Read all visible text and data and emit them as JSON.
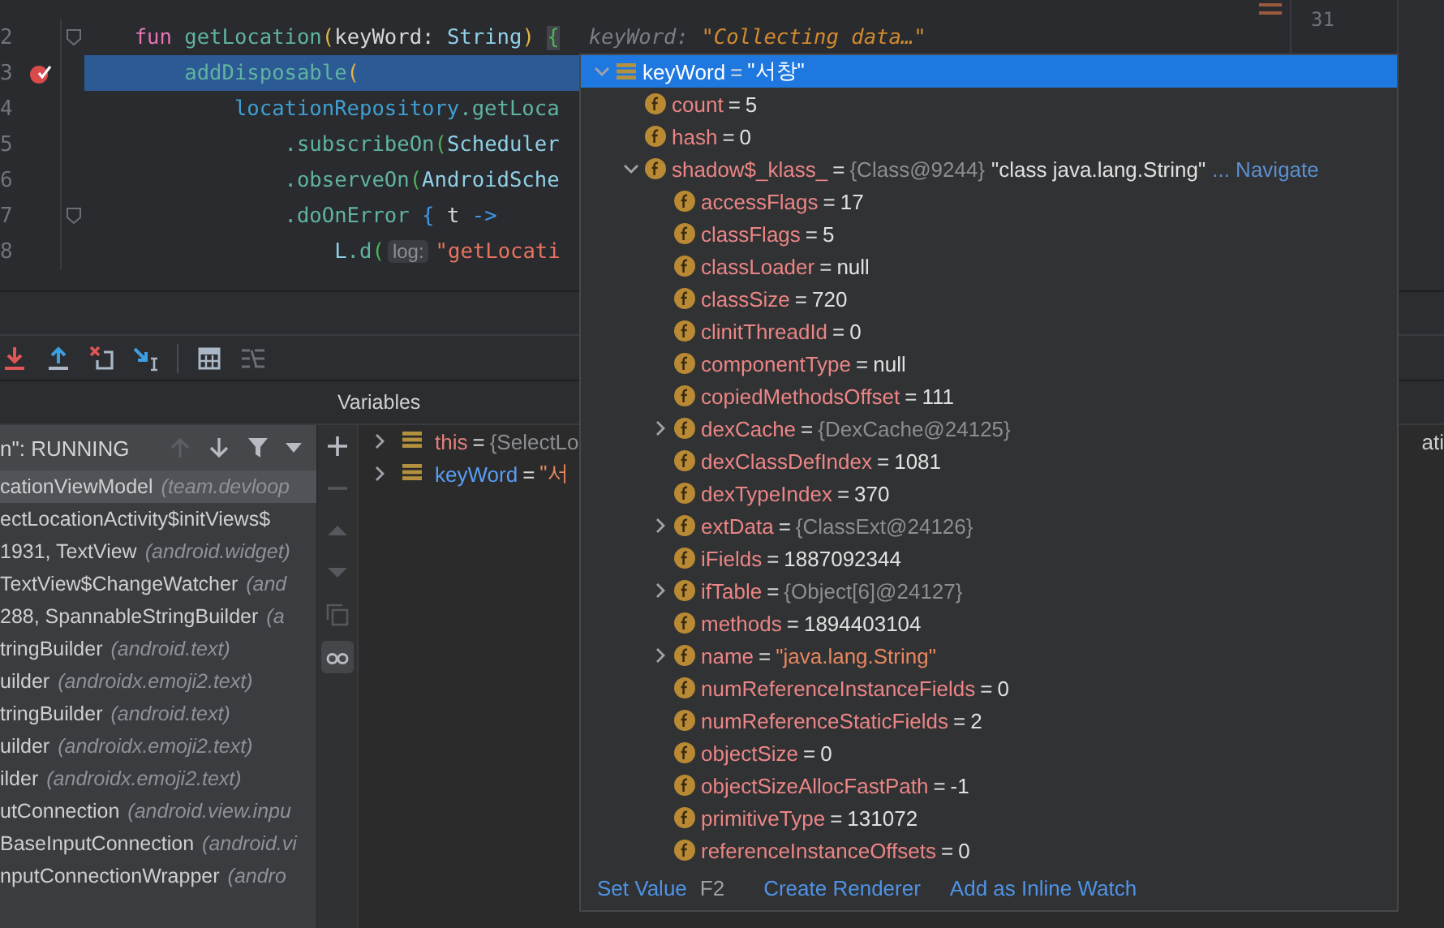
{
  "editor": {
    "lines": [
      {
        "number": "2",
        "fold": true,
        "breakpoint": false,
        "highlighted": false,
        "tokens": [
          {
            "kind": "keyword",
            "text": "    fun "
          },
          {
            "kind": "function",
            "text": "getLocation"
          },
          {
            "kind": "paren",
            "text": "("
          },
          {
            "kind": "plain",
            "text": "keyWord: "
          },
          {
            "kind": "type",
            "text": "String"
          },
          {
            "kind": "paren",
            "text": ") "
          },
          {
            "kind": "brace_match",
            "text": "{"
          }
        ],
        "inline_value": {
          "name": "keyWord:",
          "value": "\"Collecting data…\""
        }
      },
      {
        "number": "3",
        "fold": false,
        "breakpoint": true,
        "highlighted": true,
        "tokens": [
          {
            "kind": "function",
            "text": "        addDisposable"
          },
          {
            "kind": "paren",
            "text": "("
          }
        ]
      },
      {
        "number": "4",
        "fold": false,
        "breakpoint": false,
        "highlighted": false,
        "tokens": [
          {
            "kind": "property",
            "text": "            locationRepository"
          },
          {
            "kind": "function",
            "text": ".getLoca"
          }
        ]
      },
      {
        "number": "5",
        "fold": false,
        "breakpoint": false,
        "highlighted": false,
        "tokens": [
          {
            "kind": "function",
            "text": "                .subscribeOn"
          },
          {
            "kind": "paren2",
            "text": "("
          },
          {
            "kind": "type",
            "text": "Scheduler"
          }
        ]
      },
      {
        "number": "6",
        "fold": false,
        "breakpoint": false,
        "highlighted": false,
        "tokens": [
          {
            "kind": "function",
            "text": "                .observeOn"
          },
          {
            "kind": "paren2",
            "text": "("
          },
          {
            "kind": "type",
            "text": "AndroidSche"
          }
        ]
      },
      {
        "number": "7",
        "fold": true,
        "breakpoint": false,
        "highlighted": false,
        "tokens": [
          {
            "kind": "function",
            "text": "                .doOnError "
          },
          {
            "kind": "brace",
            "text": "{"
          },
          {
            "kind": "plain",
            "text": " t "
          },
          {
            "kind": "brace",
            "text": "->"
          }
        ]
      },
      {
        "number": "8",
        "fold": false,
        "breakpoint": false,
        "highlighted": false,
        "tokens": [
          {
            "kind": "type",
            "text": "                    L"
          },
          {
            "kind": "function",
            "text": ".d"
          },
          {
            "kind": "paren2",
            "text": "("
          },
          {
            "kind": "hint",
            "text": "log:"
          },
          {
            "kind": "string",
            "text": "\"getLocati"
          }
        ]
      }
    ],
    "split_line_numbers": [
      "31"
    ]
  },
  "debugger": {
    "toolbar": [
      {
        "kind": "step_into",
        "disabled": false
      },
      {
        "kind": "step_out",
        "disabled": false
      },
      {
        "kind": "drop_frame",
        "disabled": false
      },
      {
        "kind": "run_to_cursor",
        "disabled": false
      },
      {
        "kind": "separator"
      },
      {
        "kind": "evaluate",
        "disabled": false
      },
      {
        "kind": "trace",
        "disabled": true
      }
    ],
    "thread": {
      "label": "n\": RUNNING",
      "tools": [
        {
          "kind": "up",
          "disabled": true
        },
        {
          "kind": "down",
          "disabled": false
        },
        {
          "kind": "filter",
          "disabled": false
        },
        {
          "kind": "caret",
          "disabled": false
        }
      ]
    },
    "frames": [
      {
        "method": "cationViewModel",
        "package": "(team.devloop",
        "selected": true
      },
      {
        "method": "ectLocationActivity$initViews$",
        "selected": false
      },
      {
        "method": "1931, TextView",
        "package": "(android.widget)",
        "selected": false
      },
      {
        "method": "TextView$ChangeWatcher",
        "package": "(and",
        "selected": false
      },
      {
        "method": "288, SpannableStringBuilder",
        "package": "(a",
        "selected": false
      },
      {
        "method": "tringBuilder",
        "package": "(android.text)",
        "selected": false
      },
      {
        "method": "uilder",
        "package": "(androidx.emoji2.text)",
        "selected": false
      },
      {
        "method": "tringBuilder",
        "package": "(android.text)",
        "selected": false
      },
      {
        "method": "uilder",
        "package": "(androidx.emoji2.text)",
        "selected": false
      },
      {
        "method": "ilder",
        "package": "(androidx.emoji2.text)",
        "selected": false
      },
      {
        "method": "utConnection",
        "package": "(android.view.inpu",
        "selected": false
      },
      {
        "method": "BaseInputConnection",
        "package": "(android.vi",
        "selected": false
      },
      {
        "method": "nputConnectionWrapper",
        "package": "(andro",
        "selected": false
      }
    ],
    "side_tools": [
      {
        "kind": "add",
        "disabled": false,
        "selected": false
      },
      {
        "kind": "remove",
        "disabled": true,
        "selected": false
      },
      {
        "kind": "up",
        "disabled": true,
        "selected": false
      },
      {
        "kind": "down",
        "disabled": true,
        "selected": false
      },
      {
        "kind": "copy",
        "disabled": true,
        "selected": false
      },
      {
        "kind": "glasses",
        "disabled": false,
        "selected": true
      }
    ],
    "variables": {
      "title": "Variables",
      "items": [
        {
          "name": "this",
          "color": "#e57f7f",
          "eq": "=",
          "reference": "{SelectLo",
          "tail": "ati",
          "expanded": false
        },
        {
          "name": "keyWord",
          "color": "#589df6",
          "eq": "=",
          "string_value": "\"서",
          "expanded": false
        }
      ]
    }
  },
  "popup": {
    "root": {
      "kind": "object",
      "name": "keyWord",
      "eq": "=",
      "string_value": "\"서창\"",
      "expandable": true,
      "expanded": true,
      "selected": true,
      "children": [
        {
          "kind": "field",
          "name": "count",
          "eq": "=",
          "value": "5",
          "expandable": false,
          "selected": false
        },
        {
          "kind": "field",
          "name": "hash",
          "eq": "=",
          "value": "0",
          "expandable": false,
          "selected": false
        },
        {
          "kind": "field",
          "name": "shadow$_klass_",
          "eq": "=",
          "reference": "{Class@9244}",
          "detail": "\"class java.lang.String\"",
          "link": "... Navigate",
          "expandable": true,
          "expanded": true,
          "selected": false,
          "children": [
            {
              "kind": "field",
              "name": "accessFlags",
              "eq": "=",
              "value": "17",
              "expandable": false,
              "selected": false
            },
            {
              "kind": "field",
              "name": "classFlags",
              "eq": "=",
              "value": "5",
              "expandable": false,
              "selected": false
            },
            {
              "kind": "field",
              "name": "classLoader",
              "eq": "=",
              "value": "null",
              "expandable": false,
              "selected": false
            },
            {
              "kind": "field",
              "name": "classSize",
              "eq": "=",
              "value": "720",
              "expandable": false,
              "selected": false
            },
            {
              "kind": "field",
              "name": "clinitThreadId",
              "eq": "=",
              "value": "0",
              "expandable": false,
              "selected": false
            },
            {
              "kind": "field",
              "name": "componentType",
              "eq": "=",
              "value": "null",
              "expandable": false,
              "selected": false
            },
            {
              "kind": "field",
              "name": "copiedMethodsOffset",
              "eq": "=",
              "value": "111",
              "expandable": false,
              "selected": false
            },
            {
              "kind": "field",
              "name": "dexCache",
              "eq": "=",
              "reference": "{DexCache@24125}",
              "expandable": true,
              "expanded": false,
              "selected": false
            },
            {
              "kind": "field",
              "name": "dexClassDefIndex",
              "eq": "=",
              "value": "1081",
              "expandable": false,
              "selected": false
            },
            {
              "kind": "field",
              "name": "dexTypeIndex",
              "eq": "=",
              "value": "370",
              "expandable": false,
              "selected": false
            },
            {
              "kind": "field",
              "name": "extData",
              "eq": "=",
              "reference": "{ClassExt@24126}",
              "expandable": true,
              "expanded": false,
              "selected": false
            },
            {
              "kind": "field",
              "name": "iFields",
              "eq": "=",
              "value": "1887092344",
              "expandable": false,
              "selected": false
            },
            {
              "kind": "field",
              "name": "ifTable",
              "eq": "=",
              "reference": "{Object[6]@24127}",
              "expandable": true,
              "expanded": false,
              "selected": false
            },
            {
              "kind": "field",
              "name": "methods",
              "eq": "=",
              "value": "1894403104",
              "expandable": false,
              "selected": false
            },
            {
              "kind": "field",
              "name": "name",
              "eq": "=",
              "string_value": "\"java.lang.String\"",
              "expandable": true,
              "expanded": false,
              "selected": false
            },
            {
              "kind": "field",
              "name": "numReferenceInstanceFields",
              "eq": "=",
              "value": "0",
              "expandable": false,
              "selected": false
            },
            {
              "kind": "field",
              "name": "numReferenceStaticFields",
              "eq": "=",
              "value": "2",
              "expandable": false,
              "selected": false
            },
            {
              "kind": "field",
              "name": "objectSize",
              "eq": "=",
              "value": "0",
              "expandable": false,
              "selected": false
            },
            {
              "kind": "field",
              "name": "objectSizeAllocFastPath",
              "eq": "=",
              "value": "-1",
              "expandable": false,
              "selected": false
            },
            {
              "kind": "field",
              "name": "primitiveType",
              "eq": "=",
              "value": "131072",
              "expandable": false,
              "selected": false
            },
            {
              "kind": "field",
              "name": "referenceInstanceOffsets",
              "eq": "=",
              "value": "0",
              "expandable": false,
              "selected": false
            }
          ]
        }
      ]
    },
    "footer": [
      {
        "kind": "link",
        "text": "Set Value"
      },
      {
        "kind": "shortcut",
        "text": "F2"
      },
      {
        "kind": "link",
        "text": "Create Renderer"
      },
      {
        "kind": "link",
        "text": "Add as Inline Watch"
      }
    ]
  }
}
